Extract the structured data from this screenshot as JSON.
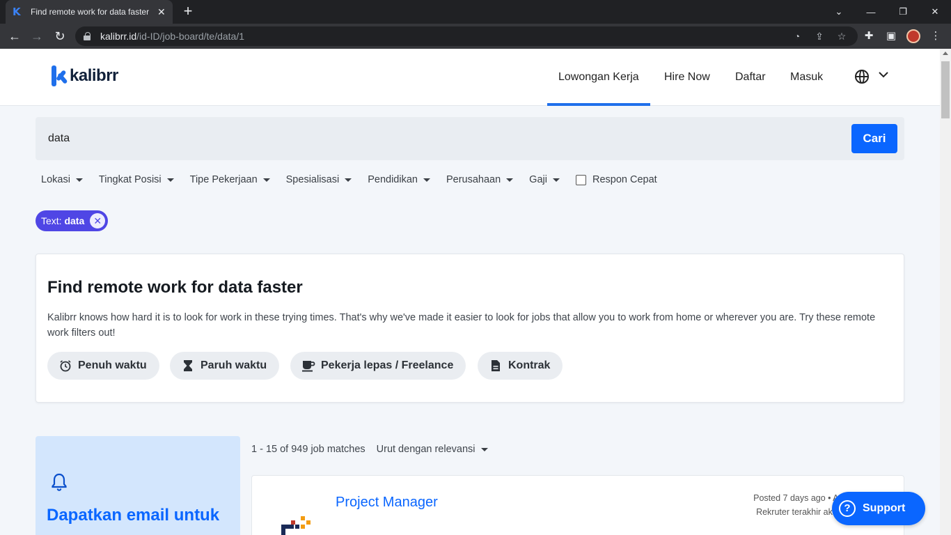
{
  "browser": {
    "tab_title": "Find remote work for data faster",
    "tab_favicon": "K",
    "url_host": "kalibrr.id",
    "url_path": "/id-ID/job-board/te/data/1"
  },
  "header": {
    "logo_text": "kalibrr",
    "nav": [
      "Lowongan Kerja",
      "Hire Now",
      "Daftar",
      "Masuk"
    ],
    "language_icon": "globe-icon"
  },
  "search": {
    "value": "data",
    "button_label": "Cari"
  },
  "filters": {
    "items": [
      "Lokasi",
      "Tingkat Posisi",
      "Tipe Pekerjaan",
      "Spesialisasi",
      "Pendidikan",
      "Perusahaan",
      "Gaji"
    ],
    "quick_response_label": "Respon Cepat"
  },
  "active_filter": {
    "prefix": "Text: ",
    "value": "data"
  },
  "remote_card": {
    "title": "Find remote work for data faster",
    "description": "Kalibrr knows how hard it is to look for work in these trying times. That's why we've made it easier to look for jobs that allow you to work from home or wherever you are. Try these remote work filters out!",
    "options": [
      {
        "label": "Penuh waktu",
        "icon": "alarm-clock-icon"
      },
      {
        "label": "Paruh waktu",
        "icon": "hourglass-icon"
      },
      {
        "label": "Pekerja lepas / Freelance",
        "icon": "coffee-cup-icon"
      },
      {
        "label": "Kontrak",
        "icon": "document-icon"
      }
    ]
  },
  "alert": {
    "title": "Dapatkan email untuk"
  },
  "results": {
    "count_text": "1 - 15 of 949 job matches",
    "sort_label": "Urut dengan relevansi"
  },
  "job": {
    "title": "Project Manager",
    "posted": "Posted 7 days ago • Apply b",
    "recruiter": "Rekruter terakhir aktif 2"
  },
  "support": {
    "label": "Support"
  },
  "colors": {
    "accent": "#0a66ff",
    "chip": "#4f46e5",
    "alert_bg": "#d3e6fd"
  }
}
